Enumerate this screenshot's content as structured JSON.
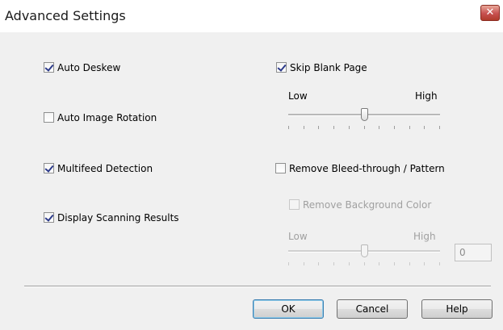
{
  "window": {
    "title": "Advanced Settings",
    "close_symbol": "✕"
  },
  "options": {
    "auto_deskew": {
      "label": "Auto Deskew",
      "checked": true
    },
    "auto_image_rotation": {
      "label": "Auto Image Rotation",
      "checked": false
    },
    "multifeed_detection": {
      "label": "Multifeed Detection",
      "checked": true
    },
    "display_scanning_results": {
      "label": "Display Scanning Results",
      "checked": true
    },
    "skip_blank_page": {
      "label": "Skip Blank Page",
      "checked": true,
      "slider": {
        "low_label": "Low",
        "high_label": "High",
        "level_fraction": 0.5
      }
    },
    "remove_bleed_through": {
      "label": "Remove Bleed-through / Pattern",
      "checked": false
    },
    "remove_background_color": {
      "label": "Remove Background Color",
      "checked": false,
      "enabled": false,
      "slider": {
        "low_label": "Low",
        "high_label": "High",
        "level_fraction": 0.5
      },
      "value": "0"
    }
  },
  "buttons": {
    "ok": "OK",
    "cancel": "Cancel",
    "help": "Help"
  }
}
